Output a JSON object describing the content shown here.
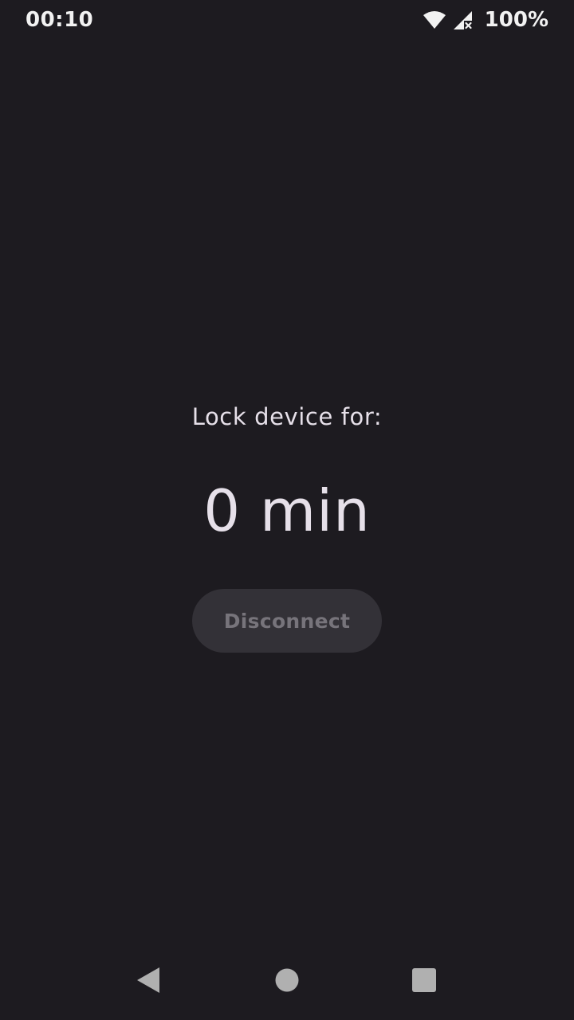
{
  "status_bar": {
    "time": "00:10",
    "battery": "100%",
    "icons": [
      "wifi-icon",
      "cellular-signal-icon"
    ]
  },
  "main": {
    "label": "Lock device for:",
    "value": "0 min",
    "button_label": "Disconnect"
  },
  "nav_bar": {
    "icons": [
      "back-icon",
      "home-icon",
      "recents-icon"
    ]
  },
  "colors": {
    "background": "#1d1b20",
    "text": "#e6e0e9",
    "button_background": "#333137",
    "button_text_disabled": "#77747b",
    "nav_icon": "#b0b0b0"
  }
}
